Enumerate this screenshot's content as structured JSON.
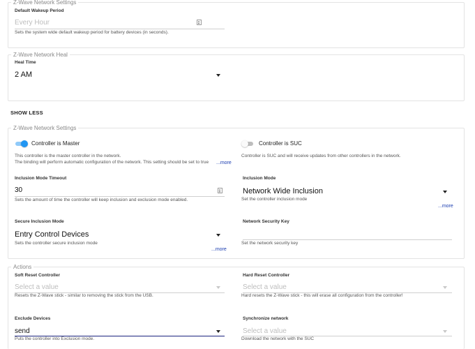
{
  "wakeup": {
    "legend": "Z-Wave Network Settings",
    "label": "Default Wakeup Period",
    "placeholder": "Every Hour",
    "help": "Sets the system wide default wakeup period for battery devices (in seconds)."
  },
  "heal": {
    "legend": "Z-Wave Network Heal",
    "label": "Heal Time",
    "value": "2 AM"
  },
  "show_less": "SHOW LESS",
  "network": {
    "legend": "Z-Wave Network Settings",
    "master": {
      "label": "Controller is Master",
      "on": true,
      "help1": "This controller is the master controller in the network.",
      "help2": "The binding will perform automatic configuration of the network. This setting should be set to true",
      "more": "...more"
    },
    "suc": {
      "label": "Controller is SUC",
      "on": false,
      "help": "Controller is SUC and will receive updates from other controllers in the network."
    },
    "timeout": {
      "label": "Inclusion Mode Timeout",
      "value": "30",
      "help": "Sets the amount of time the controller will keep inclusion and exclusion mode enabled."
    },
    "inclusion_mode": {
      "label": "Inclusion Mode",
      "value": "Network Wide Inclusion",
      "help": "Set the controller inclusion mode",
      "more": "...more"
    },
    "secure_mode": {
      "label": "Secure Inclusion Mode",
      "value": "Entry Control Devices",
      "help": "Sets the controller secure inclusion mode",
      "more": "...more"
    },
    "security_key": {
      "label": "Network Security Key",
      "value": "",
      "help": "Set the network security key"
    }
  },
  "actions": {
    "legend": "Actions",
    "soft_reset": {
      "label": "Soft Reset Controller",
      "placeholder": "Select a value",
      "help": "Resets the Z-Wave stick - similar to removing the stick from the USB."
    },
    "hard_reset": {
      "label": "Hard Reset Controller",
      "placeholder": "Select a value",
      "help": "Hard resets the Z-Wave stick - this will erase all configuration from the controller!"
    },
    "exclude": {
      "label": "Exclude Devices",
      "value": "send",
      "help": "Puts the controller into Exclusion mode."
    },
    "sync": {
      "label": "Synchronize network",
      "placeholder": "Select a value",
      "help": "Download the network with the SUC"
    }
  },
  "colors": {
    "toggle_on_track": "#90caf9",
    "toggle_on_knob": "#2196f3",
    "toggle_off_track": "#bdbdbd",
    "toggle_off_knob": "#fafafa",
    "link": "#1a3cb0",
    "focus_underline": "#1a237e"
  }
}
